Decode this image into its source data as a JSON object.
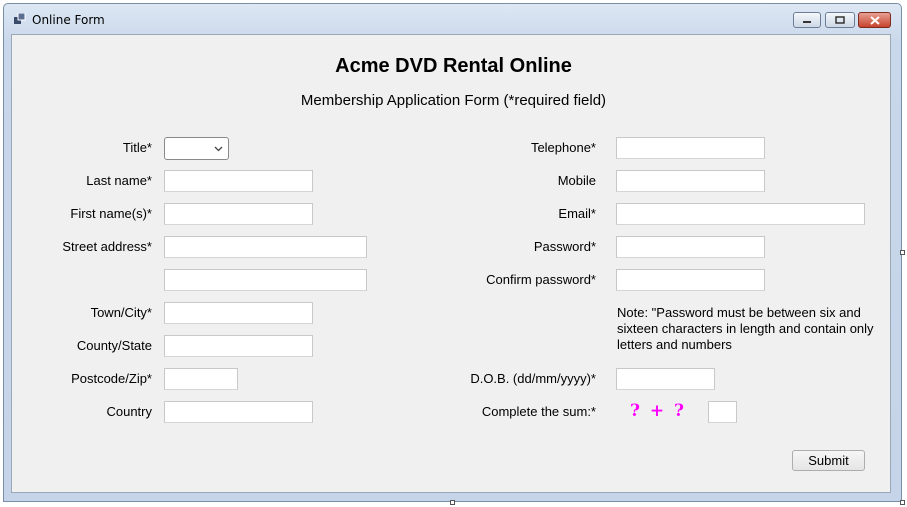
{
  "window": {
    "title": "Online Form"
  },
  "form": {
    "heading": "Acme DVD Rental Online",
    "subheading": "Membership Application Form (*required field)",
    "left_labels": {
      "title": "Title*",
      "last_name": "Last name*",
      "first_names": "First name(s)*",
      "street_address": "Street address*",
      "town_city": "Town/City*",
      "county_state": "County/State",
      "postcode_zip": "Postcode/Zip*",
      "country": "Country"
    },
    "right_labels": {
      "telephone": "Telephone*",
      "mobile": "Mobile",
      "email": "Email*",
      "password": "Password*",
      "confirm_password": "Confirm password*",
      "dob": "D.O.B. (dd/mm/yyyy)*",
      "complete_sum": "Complete the sum:*"
    },
    "password_note": "Note: \"Password must be between six and sixteen characters in length and contain only letters and numbers",
    "captcha_text": "? + ?",
    "submit_label": "Submit",
    "values": {
      "title": "",
      "last_name": "",
      "first_names": "",
      "street_address_1": "",
      "street_address_2": "",
      "town_city": "",
      "county_state": "",
      "postcode_zip": "",
      "country": "",
      "telephone": "",
      "mobile": "",
      "email": "",
      "password": "",
      "confirm_password": "",
      "dob": "",
      "sum_answer": ""
    }
  },
  "colors": {
    "client_background": "#f0f0f0",
    "captcha": "#ff00ff",
    "close_button": "#c6432d"
  },
  "icons": {
    "app": "window-app-icon",
    "minimize": "minimize-icon",
    "maximize": "maximize-icon",
    "close": "close-icon",
    "dropdown": "chevron-down-icon"
  }
}
